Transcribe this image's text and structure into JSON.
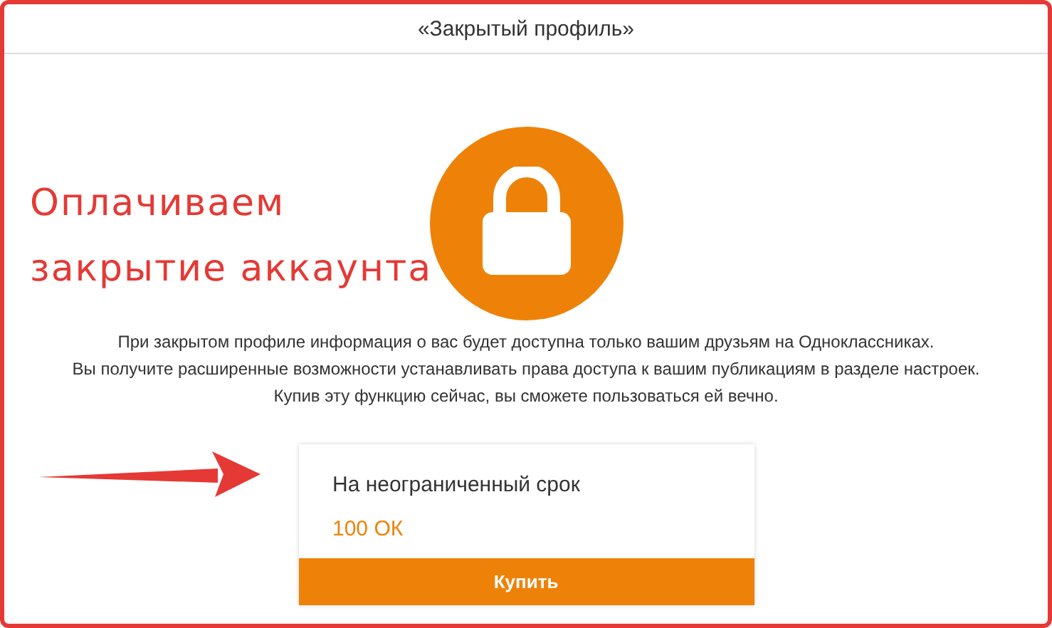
{
  "window": {
    "title": "«Закрытый профиль»"
  },
  "annotation": {
    "lines": [
      "Оплачиваем",
      "закрытие аккаунта"
    ]
  },
  "description": [
    "При закрытом профиле информация о вас будет доступна только вашим друзьям на Одноклассниках.",
    "Вы получите расширенные возможности устанавливать права доступа к вашим публикациям в разделе настроек.",
    "Купив эту функцию сейчас, вы сможете пользоваться ей вечно."
  ],
  "offer": {
    "term": "На неограниченный срок",
    "price": "100 ОК",
    "button": "Купить"
  }
}
